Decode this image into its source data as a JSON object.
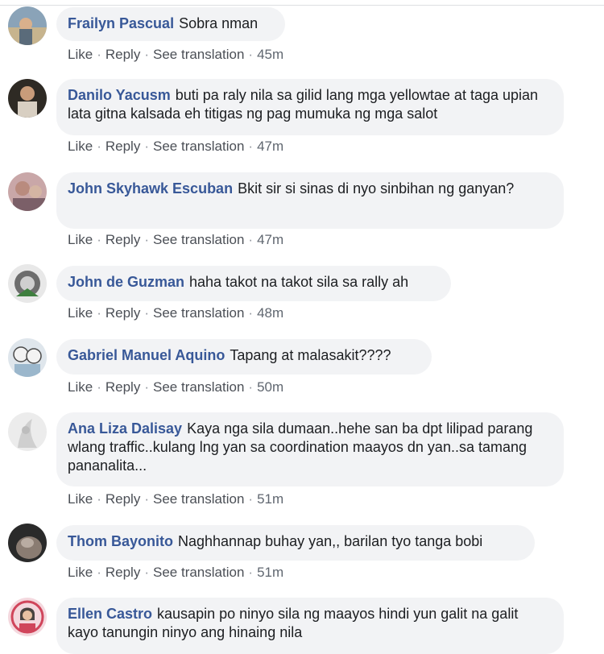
{
  "actions": {
    "like": "Like",
    "reply": "Reply",
    "translate": "See translation",
    "sep": "·"
  },
  "colors": {
    "author_link": "#385898",
    "bubble_bg": "#f2f3f5",
    "meta_text": "#606770"
  },
  "comments": [
    {
      "author": "Frailyn Pascual",
      "text": "Sobra nman",
      "time": "45m",
      "avatar_icon": "profile-photo"
    },
    {
      "author": "Danilo Yacusm",
      "text": "buti pa raly nila sa gilid lang mga yellowtae at taga upian lata gitna kalsada eh titigas ng pag mumuka ng mga salot",
      "time": "47m",
      "avatar_icon": "profile-photo"
    },
    {
      "author": "John Skyhawk Escuban",
      "text": "Bkit sir si sinas di nyo sinbihan ng ganyan?",
      "time": "47m",
      "avatar_icon": "profile-photo"
    },
    {
      "author": "John de Guzman",
      "text": "haha takot na takot sila sa rally ah",
      "time": "48m",
      "avatar_icon": "profile-photo"
    },
    {
      "author": "Gabriel Manuel Aquino",
      "text": "Tapang at malasakit????",
      "time": "50m",
      "avatar_icon": "profile-photo"
    },
    {
      "author": "Ana Liza Dalisay",
      "text": "Kaya nga sila dumaan..hehe san ba dpt lilipad parang wlang traffic..kulang lng yan sa coordination maayos dn yan..sa tamang pananalita...",
      "time": "51m",
      "avatar_icon": "profile-photo"
    },
    {
      "author": "Thom Bayonito",
      "text": "Naghhannap buhay yan,, barilan tyo tanga bobi",
      "time": "51m",
      "avatar_icon": "profile-photo"
    },
    {
      "author": "Ellen Castro",
      "text": "kausapin po ninyo sila ng maayos hindi yun galit na galit kayo tanungin ninyo ang hinaing nila",
      "time": "",
      "avatar_icon": "profile-photo"
    }
  ]
}
